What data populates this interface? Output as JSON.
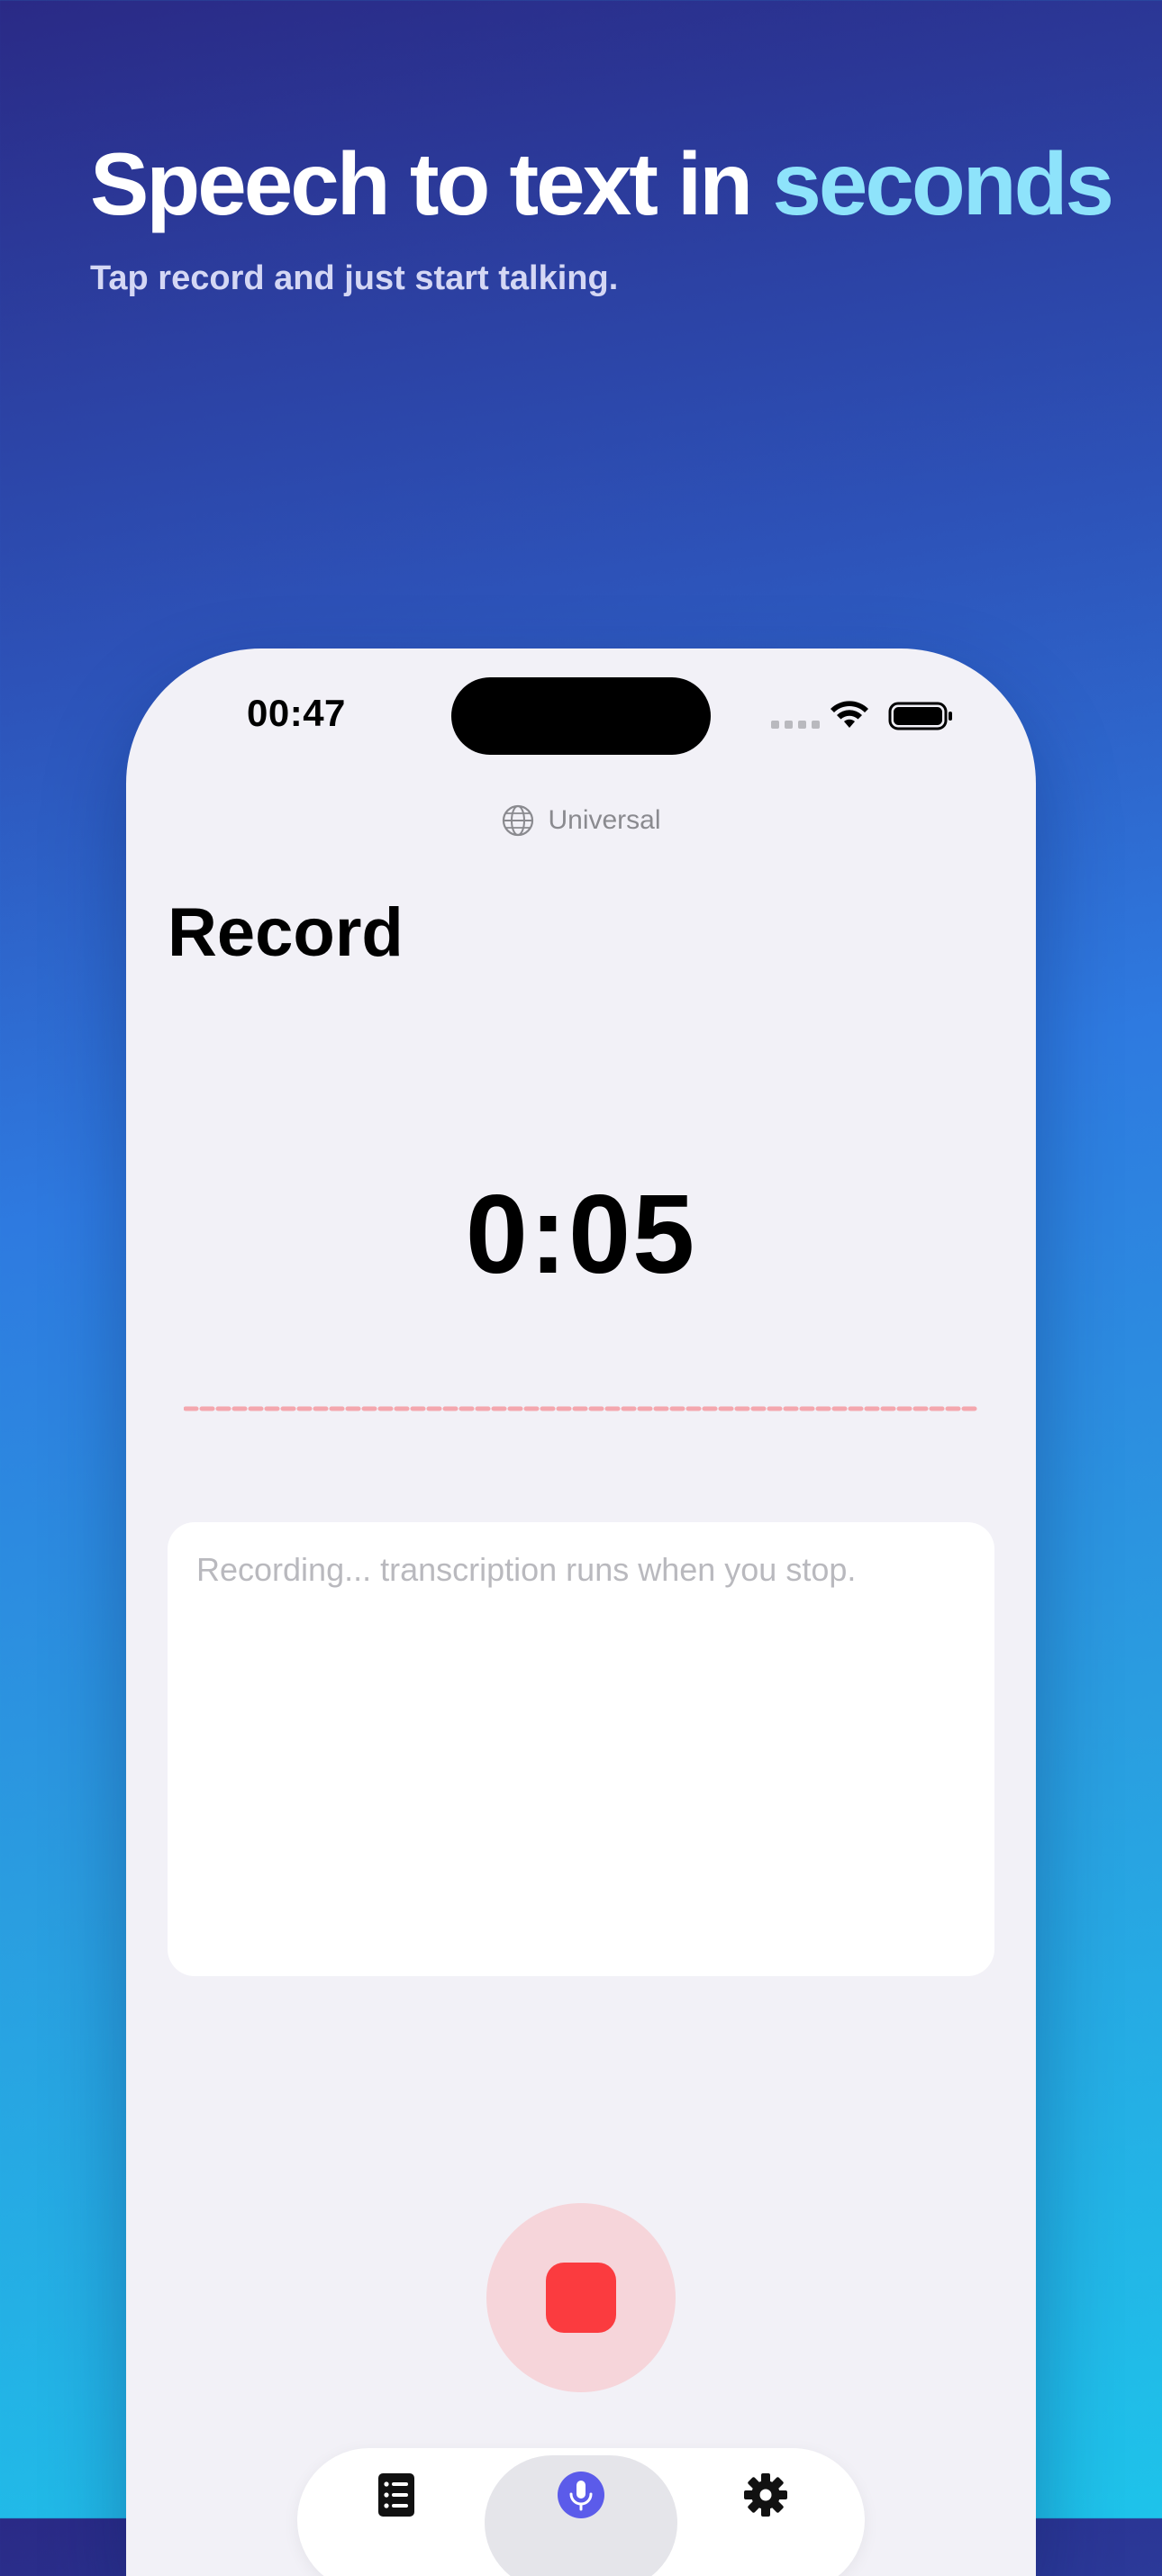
{
  "marketing": {
    "headline_main": "Speech to text in ",
    "headline_accent": "seconds",
    "subheadline": "Tap record and just start talking.",
    "accent_color": "#8ee3fb"
  },
  "status_bar": {
    "time": "00:47",
    "icons": [
      "cellular-icon",
      "wifi-icon",
      "battery-icon"
    ]
  },
  "language": {
    "icon": "globe-icon",
    "label": "Universal"
  },
  "screen": {
    "title": "Record",
    "timer": "0:05"
  },
  "transcript": {
    "placeholder": "Recording... transcription runs when you stop."
  },
  "record_button": {
    "state": "recording",
    "icon": "stop-icon",
    "color": "#fb3b3f"
  },
  "tab_bar": {
    "tabs": [
      {
        "icon": "list-icon",
        "selected": false
      },
      {
        "icon": "microphone-icon",
        "selected": true
      },
      {
        "icon": "gear-icon",
        "selected": false
      }
    ]
  }
}
